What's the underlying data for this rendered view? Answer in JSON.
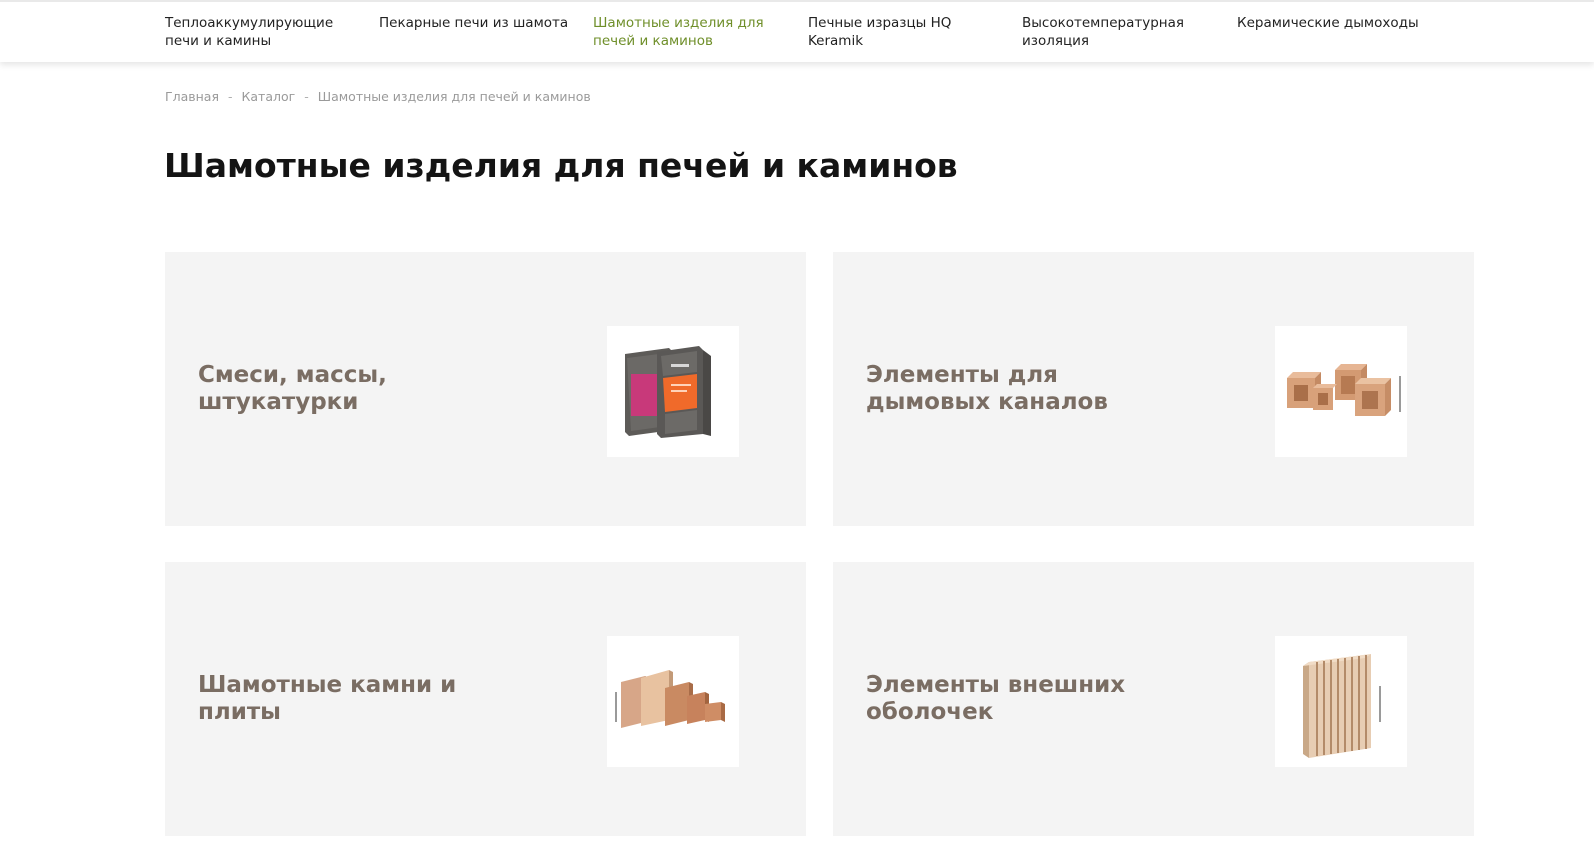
{
  "nav": {
    "items": [
      {
        "label": "Теплоаккумулирующие печи и камины",
        "active": false
      },
      {
        "label": "Пекарные печи из шамота",
        "active": false
      },
      {
        "label": "Шамотные изделия для печей и каминов",
        "active": true
      },
      {
        "label": "Печные изразцы HQ Keramik",
        "active": false
      },
      {
        "label": "Высокотемпературная изоляция",
        "active": false
      },
      {
        "label": "Керамические дымоходы",
        "active": false
      }
    ],
    "active_color": "#6f8f2a"
  },
  "breadcrumb": {
    "home": "Главная",
    "catalog": "Каталог",
    "current": "Шамотные изделия для печей и каминов",
    "separator": "-"
  },
  "page": {
    "title": "Шамотные изделия для печей и каминов"
  },
  "cards": [
    {
      "title": "Смеси, массы, штукатурки",
      "image": "mortar-bags-image"
    },
    {
      "title": "Элементы для дымовых каналов",
      "image": "chimney-blocks-image"
    },
    {
      "title": "Шамотные камни и плиты",
      "image": "firebricks-image"
    },
    {
      "title": "Элементы внешних оболочек",
      "image": "cladding-panel-image"
    }
  ],
  "colors": {
    "card_bg": "#f4f4f4",
    "card_title": "#7a6d63",
    "title": "#141414",
    "breadcrumb": "#9a9a9a"
  }
}
